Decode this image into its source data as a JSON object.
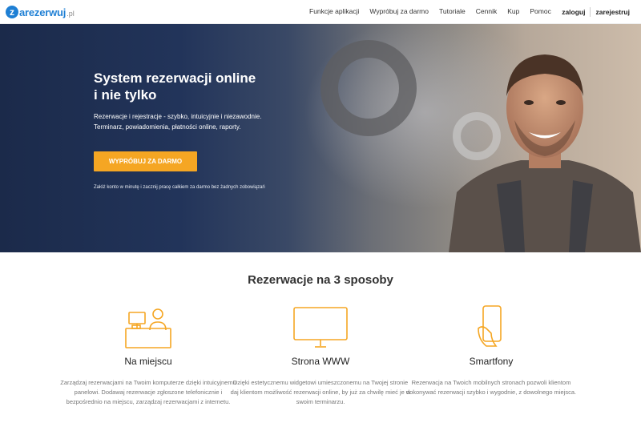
{
  "header": {
    "logo_mark": "z",
    "logo_text": "arezerwuj",
    "logo_tld": ".pl",
    "menu": [
      {
        "label": "Funkcje aplikacji"
      },
      {
        "label": "Wypróbuj za darmo"
      },
      {
        "label": "Tutoriale"
      },
      {
        "label": "Cennik"
      },
      {
        "label": "Kup"
      },
      {
        "label": "Pomoc"
      }
    ],
    "login": "zaloguj",
    "register": "zarejestruj"
  },
  "hero": {
    "title_line1": "System rezerwacji online",
    "title_line2": "i nie tylko",
    "desc_line1": "Rezerwacje i rejestracje - szybko, intuicyjnie i niezawodnie.",
    "desc_line2": "Terminarz, powiadomienia, płatności online, raporty.",
    "cta_label": "WYPRÓBUJ ZA DARMO",
    "note": "Załóż konto w minutę i zacznij pracę całkiem za darmo bez żadnych zobowiązań"
  },
  "features": {
    "title": "Rezerwacje na 3 sposoby",
    "accent_color": "#f5a623",
    "items": [
      {
        "icon": "desk-reception-icon",
        "title": "Na miejscu",
        "text": "Zarządzaj rezerwacjami na Twoim komputerze dzięki intuicyjnemu panelowi. Dodawaj rezerwacje zgłoszone telefonicznie i bezpośrednio na miejscu, zarządzaj rezerwacjami z internetu."
      },
      {
        "icon": "monitor-icon",
        "title": "Strona WWW",
        "text": "Dzięki estetycznemu widgetowi umieszczonemu na Twojej stronie daj klientom możliwość rezerwacji online, by już za chwilę mieć je w swoim terminarzu."
      },
      {
        "icon": "smartphone-icon",
        "title": "Smartfony",
        "text": "Rezerwacja na Twoich mobilnych stronach pozwoli klientom dokonywać rezerwacji szybko i wygodnie, z dowolnego miejsca."
      }
    ]
  }
}
